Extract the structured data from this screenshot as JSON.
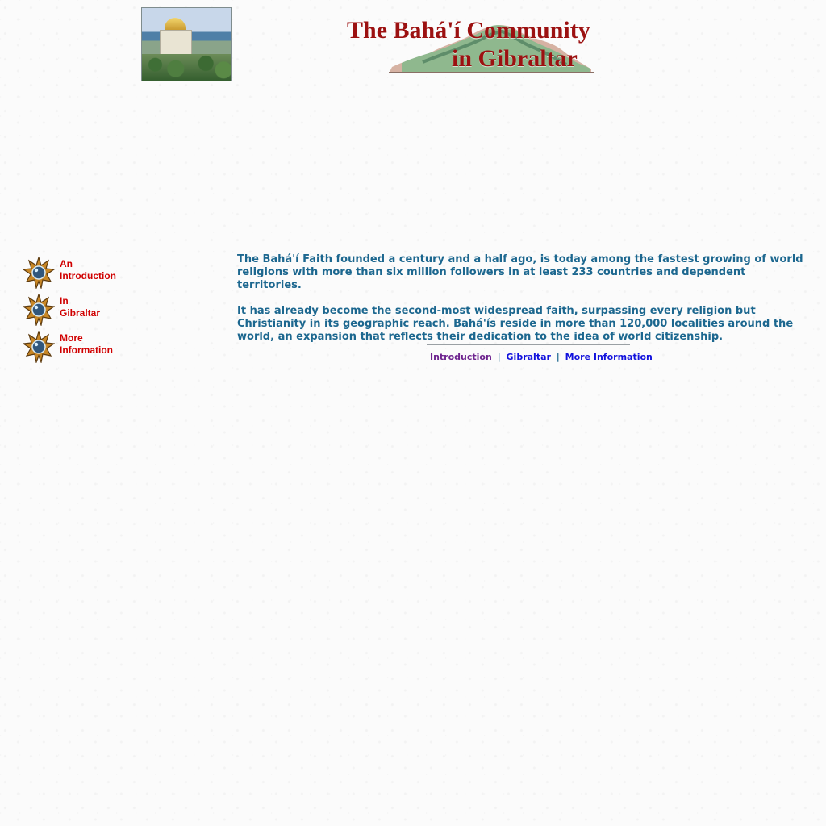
{
  "header": {
    "photo_icon": "bahai-shrine-photo",
    "title_line_1": "The Bahá'í Community",
    "title_line_2": "in Gibraltar",
    "title_color": "#9c1111",
    "rock_icon": "gibraltar-rock-illustration"
  },
  "sidebar": {
    "items": [
      {
        "label": "An\nIntroduction",
        "icon": "nine-pointed-star-icon"
      },
      {
        "label": "In\nGibraltar",
        "icon": "nine-pointed-star-icon"
      },
      {
        "label": "More\nInformation",
        "icon": "nine-pointed-star-icon"
      }
    ],
    "label_color": "#d00000"
  },
  "main": {
    "paragraphs": [
      "The Bahá'í Faith founded a century and a half ago, is today among the fastest growing of world religions with more than six million followers in at least 233 countries and dependent territories.",
      "It has already become the second-most widespread faith, surpassing every religion but Christianity in its geographic reach. Bahá'ís reside in more than 120,000 localities around the world, an expansion that reflects their dedication to the idea of world citizenship."
    ],
    "text_color": "#1c678f"
  },
  "footer": {
    "links": [
      {
        "label": "Introduction",
        "color": "#6e248f"
      },
      {
        "label": "Gibraltar",
        "color": "#1111dd"
      },
      {
        "label": "More Information",
        "color": "#1111dd"
      }
    ],
    "separator": "|"
  }
}
